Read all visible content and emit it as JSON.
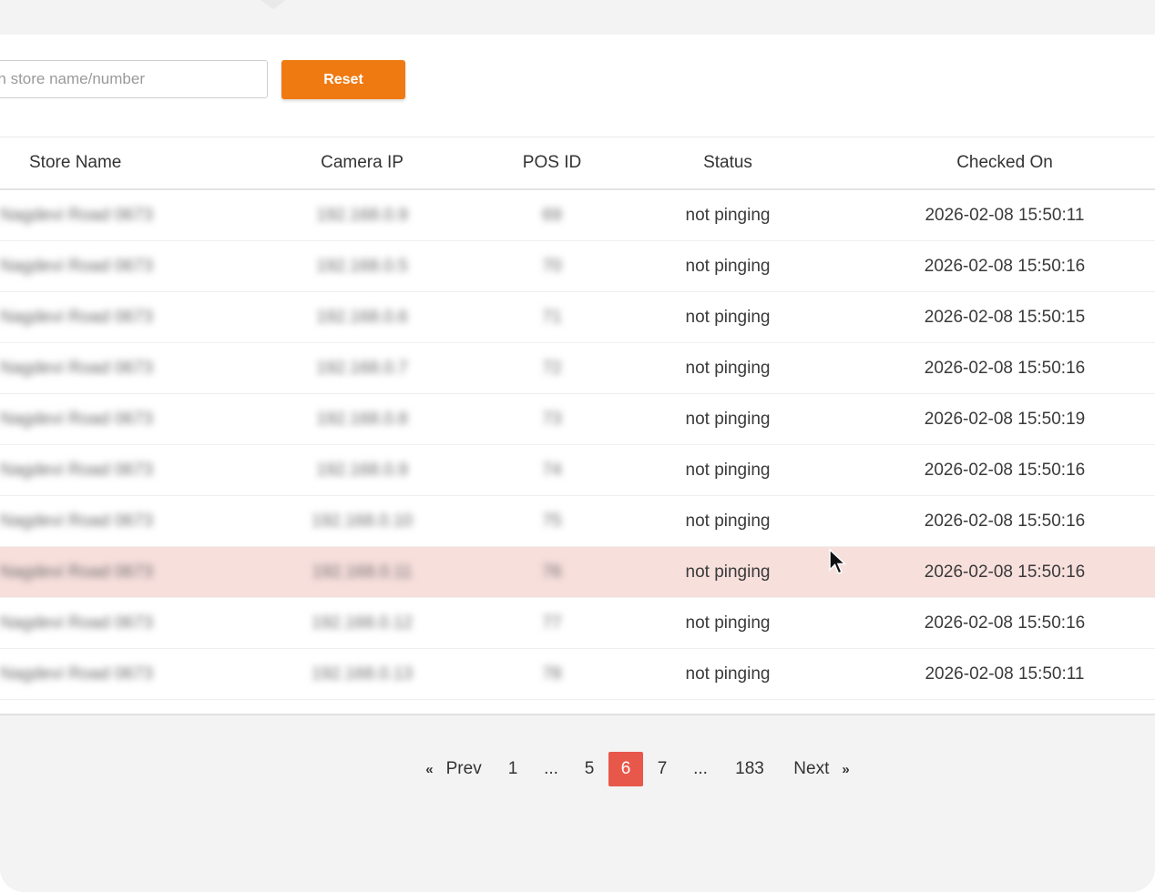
{
  "search": {
    "placeholder": "Search store name/number"
  },
  "reset_label": "Reset",
  "table": {
    "columns": [
      "Store Name",
      "Camera IP",
      "POS ID",
      "Status",
      "Checked On"
    ],
    "rows": [
      {
        "store": "Nagdevi Road 0673",
        "ip": "192.168.0.9",
        "pos": "69",
        "status": "not pinging",
        "checked_on": "2026-02-08 15:50:11",
        "highlight": false
      },
      {
        "store": "Nagdevi Road 0673",
        "ip": "192.168.0.5",
        "pos": "70",
        "status": "not pinging",
        "checked_on": "2026-02-08 15:50:16",
        "highlight": false
      },
      {
        "store": "Nagdevi Road 0673",
        "ip": "192.168.0.6",
        "pos": "71",
        "status": "not pinging",
        "checked_on": "2026-02-08 15:50:15",
        "highlight": false
      },
      {
        "store": "Nagdevi Road 0673",
        "ip": "192.168.0.7",
        "pos": "72",
        "status": "not pinging",
        "checked_on": "2026-02-08 15:50:16",
        "highlight": false
      },
      {
        "store": "Nagdevi Road 0673",
        "ip": "192.168.0.8",
        "pos": "73",
        "status": "not pinging",
        "checked_on": "2026-02-08 15:50:19",
        "highlight": false
      },
      {
        "store": "Nagdevi Road 0673",
        "ip": "192.168.0.9",
        "pos": "74",
        "status": "not pinging",
        "checked_on": "2026-02-08 15:50:16",
        "highlight": false
      },
      {
        "store": "Nagdevi Road 0673",
        "ip": "192.168.0.10",
        "pos": "75",
        "status": "not pinging",
        "checked_on": "2026-02-08 15:50:16",
        "highlight": false
      },
      {
        "store": "Nagdevi Road 0673",
        "ip": "192.168.0.11",
        "pos": "76",
        "status": "not pinging",
        "checked_on": "2026-02-08 15:50:16",
        "highlight": true
      },
      {
        "store": "Nagdevi Road 0673",
        "ip": "192.168.0.12",
        "pos": "77",
        "status": "not pinging",
        "checked_on": "2026-02-08 15:50:16",
        "highlight": false
      },
      {
        "store": "Nagdevi Road 0673",
        "ip": "192.168.0.13",
        "pos": "78",
        "status": "not pinging",
        "checked_on": "2026-02-08 15:50:11",
        "highlight": false
      }
    ]
  },
  "pagination": {
    "prev_label": "Prev",
    "next_label": "Next",
    "prev_icon": "«",
    "next_icon": "»",
    "pages": [
      "1",
      "...",
      "5",
      "6",
      "7",
      "...",
      "183"
    ],
    "current": "6"
  },
  "colors": {
    "accent": "#f07a12",
    "active_page": "#e8584a",
    "row_highlight": "#f7dfdc"
  }
}
